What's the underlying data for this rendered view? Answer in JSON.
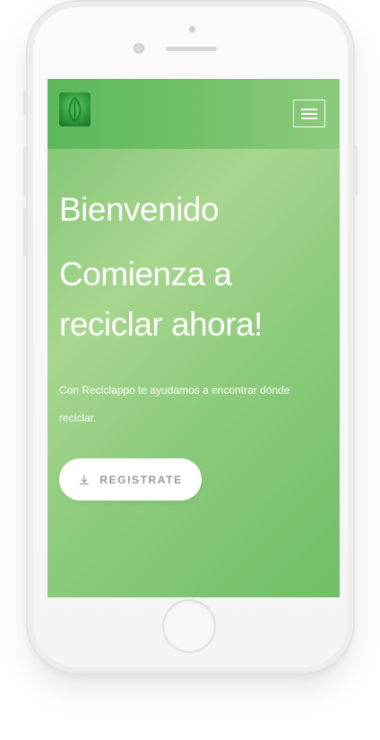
{
  "nav": {
    "logo_icon": "leaf-icon",
    "menu_icon": "hamburger-menu-icon"
  },
  "hero": {
    "title": "Bienvenido",
    "subtitle": "Comienza a reciclar ahora!",
    "text": "Con Reciclappo te ayudamos a encontrar dónde reciclar.",
    "button_label": "REGISTRATE",
    "button_icon": "download-icon"
  },
  "colors": {
    "brand_green": "#5cb85c",
    "hero_gradient_light": "#a8d68f",
    "button_text": "#9a9a9a"
  }
}
